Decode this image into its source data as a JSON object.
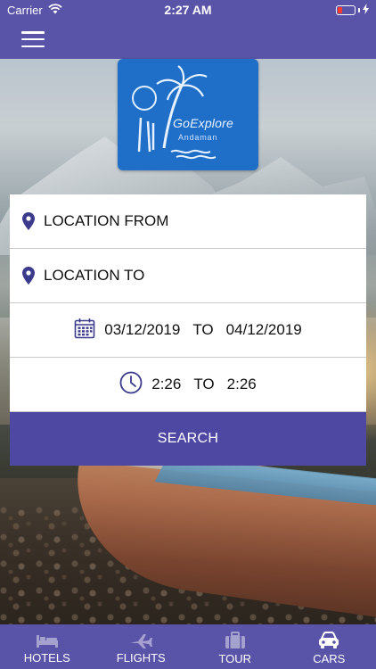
{
  "status_bar": {
    "carrier": "Carrier",
    "time": "2:27 AM",
    "battery_color": "#ff3b30"
  },
  "nav": {
    "menu_icon": "hamburger-icon",
    "bar_color": "#5a54a8"
  },
  "logo": {
    "title": "GoExplore",
    "subtitle": "Andaman",
    "background": "#1f6fc8"
  },
  "form": {
    "location_from": "LOCATION FROM",
    "location_to": "LOCATION TO",
    "date_from": "03/12/2019",
    "date_to": "04/12/2019",
    "date_separator": "TO",
    "time_from": "2:26",
    "time_to": "2:26",
    "time_separator": "TO",
    "search_label": "SEARCH",
    "accent_color": "#4e48a2"
  },
  "tabs": [
    {
      "label": "HOTELS",
      "icon": "bed-icon",
      "active": false
    },
    {
      "label": "FLIGHTS",
      "icon": "airplane-icon",
      "active": false
    },
    {
      "label": "TOUR",
      "icon": "suitcase-icon",
      "active": false
    },
    {
      "label": "CARS",
      "icon": "car-icon",
      "active": true
    }
  ]
}
